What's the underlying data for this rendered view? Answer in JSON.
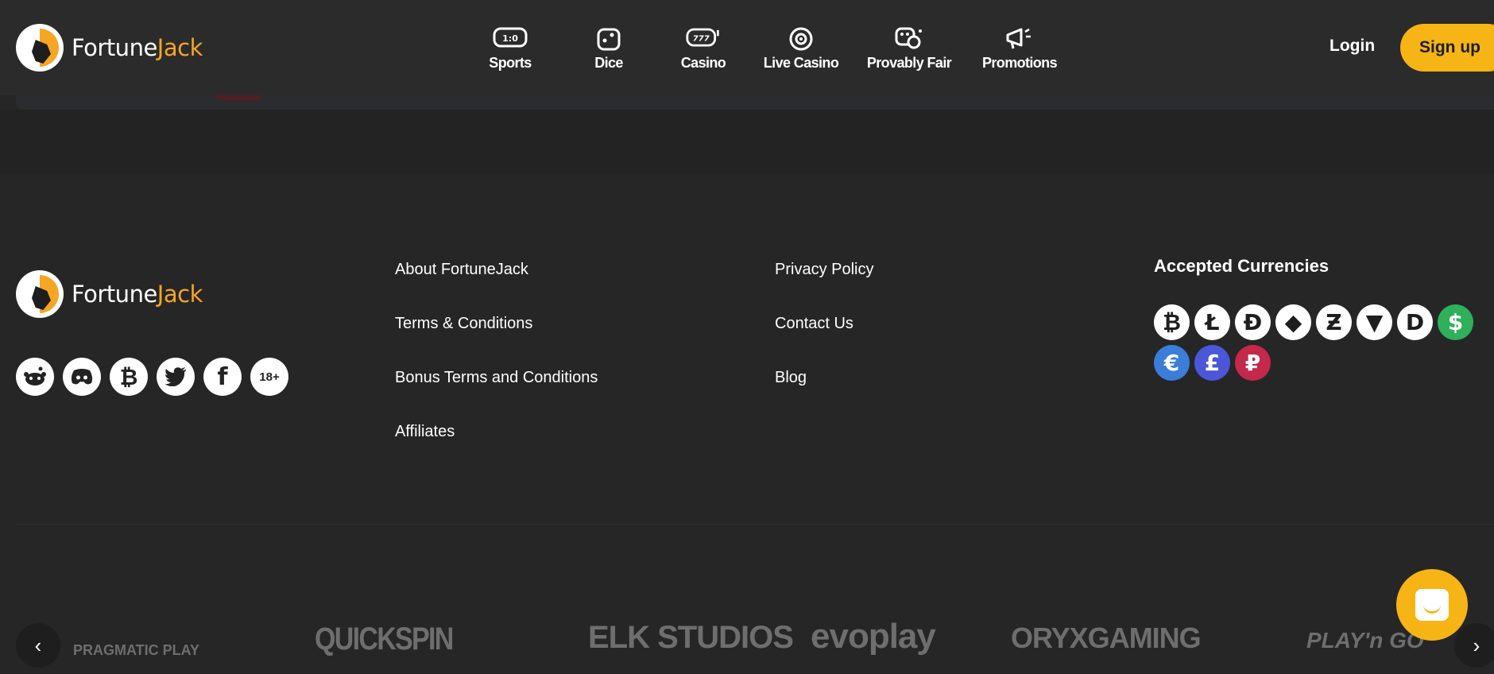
{
  "brand": {
    "name_white": "Fortune",
    "name_orange": "Jack"
  },
  "nav": [
    {
      "label": "Sports",
      "icon": "scoreboard-icon"
    },
    {
      "label": "Dice",
      "icon": "dice-icon"
    },
    {
      "label": "Casino",
      "icon": "slot-machine-icon"
    },
    {
      "label": "Live Casino",
      "icon": "target-icon"
    },
    {
      "label": "Provably Fair",
      "icon": "game-pieces-icon"
    },
    {
      "label": "Promotions",
      "icon": "megaphone-icon"
    }
  ],
  "header": {
    "login": "Login",
    "signup": "Sign up"
  },
  "nav_icon_text": {
    "sports": "1:0",
    "casino": "777"
  },
  "footer": {
    "links_col1": [
      "About FortuneJack",
      "Terms & Conditions",
      "Bonus Terms and Conditions",
      "Affiliates"
    ],
    "links_col2": [
      "Privacy Policy",
      "Contact Us",
      "Blog"
    ],
    "currencies_title": "Accepted Currencies",
    "age_badge": "18+"
  },
  "socials": [
    "reddit-icon",
    "discord-icon",
    "bitcoin-icon",
    "twitter-icon",
    "facebook-icon",
    "18plus-icon"
  ],
  "currencies": [
    {
      "symbol": "₿",
      "name": "bitcoin",
      "bg": "#ffffff",
      "fg": "#1e1e1e"
    },
    {
      "symbol": "Ł",
      "name": "litecoin",
      "bg": "#ffffff",
      "fg": "#1e1e1e"
    },
    {
      "symbol": "Đ",
      "name": "dogecoin",
      "bg": "#ffffff",
      "fg": "#1e1e1e"
    },
    {
      "symbol": "◆",
      "name": "ethereum",
      "bg": "#ffffff",
      "fg": "#1e1e1e"
    },
    {
      "symbol": "Ƶ",
      "name": "zcash",
      "bg": "#ffffff",
      "fg": "#1e1e1e"
    },
    {
      "symbol": "▼",
      "name": "tron",
      "bg": "#ffffff",
      "fg": "#1e1e1e"
    },
    {
      "symbol": "D",
      "name": "dash",
      "bg": "#ffffff",
      "fg": "#1e1e1e"
    },
    {
      "symbol": "$",
      "name": "usd",
      "bg": "#2fb05a",
      "fg": "#ffffff"
    },
    {
      "symbol": "€",
      "name": "euro",
      "bg": "#3b7dd8",
      "fg": "#ffffff"
    },
    {
      "symbol": "£",
      "name": "pound",
      "bg": "#4b57d9",
      "fg": "#ffffff"
    },
    {
      "symbol": "₽",
      "name": "ruble",
      "bg": "#c4284a",
      "fg": "#ffffff"
    }
  ],
  "partners": [
    {
      "name": "PRAGMATIC PLAY"
    },
    {
      "name": "QUICKSPIN"
    },
    {
      "name": "ELK STUDIOS"
    },
    {
      "name": "evoplay"
    },
    {
      "name": "ORYXGAMING"
    },
    {
      "name": "PLAY'n GO"
    }
  ],
  "colors": {
    "accent": "#f6b415",
    "orange": "#f6a623",
    "bg": "#262626",
    "header": "#2b2b2b"
  }
}
